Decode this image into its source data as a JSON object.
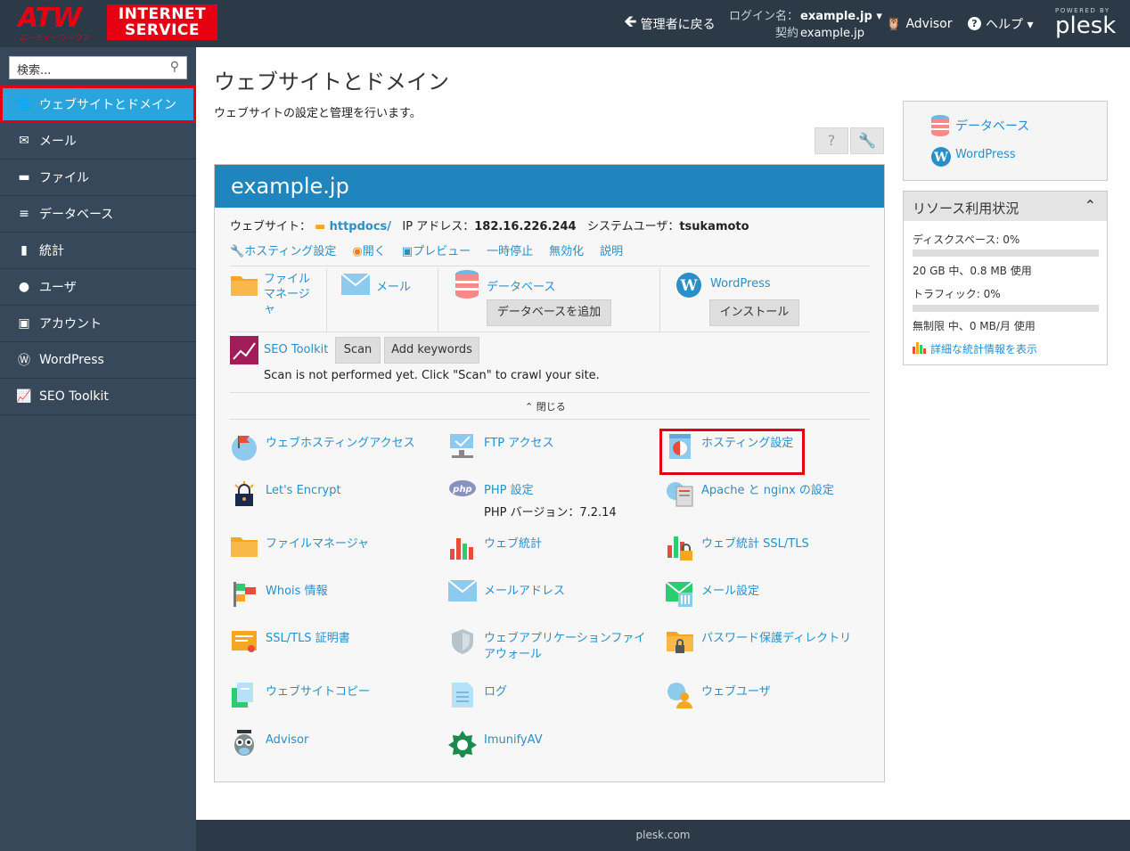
{
  "header": {
    "logo_main": "ATW",
    "logo_sub": "エーティーワークス",
    "logo_line1": "INTERNET",
    "logo_line2": "SERVICE",
    "back_label": "管理者に戻る",
    "login_label": "ログイン名：",
    "login_value": "example.jp ▾",
    "contract_label": "契約",
    "contract_value": "example.jp",
    "advisor_label": "Advisor",
    "help_label": "ヘルプ ▾",
    "powered_by": "POWERED BY",
    "brand": "plesk"
  },
  "sidebar": {
    "search_placeholder": "検索...",
    "items": [
      {
        "label": "ウェブサイトとドメイン",
        "icon": "globe-icon"
      },
      {
        "label": "メール",
        "icon": "mail-icon"
      },
      {
        "label": "ファイル",
        "icon": "folder-icon"
      },
      {
        "label": "データベース",
        "icon": "database-icon"
      },
      {
        "label": "統計",
        "icon": "chart-icon"
      },
      {
        "label": "ユーザ",
        "icon": "user-icon"
      },
      {
        "label": "アカウント",
        "icon": "account-icon"
      },
      {
        "label": "WordPress",
        "icon": "wordpress-icon"
      },
      {
        "label": "SEO Toolkit",
        "icon": "seo-icon"
      }
    ]
  },
  "main": {
    "title": "ウェブサイトとドメイン",
    "subtitle": "ウェブサイトの設定と管理を行います。",
    "domain": "example.jp",
    "website_label": "ウェブサイト：",
    "website_dir": "httpdocs/",
    "ip_label": "IP アドレス：",
    "ip_value": "182.16.226.244",
    "sysuser_label": "システムユーザ：",
    "sysuser_value": "tsukamoto",
    "actions": [
      "ホスティング設定",
      "開く",
      "プレビュー",
      "一時停止",
      "無効化",
      "説明"
    ],
    "quick": {
      "filemanager": "ファイルマネージャ",
      "mail": "メール",
      "database": "データベース",
      "add_db": "データベースを追加",
      "wordpress": "WordPress",
      "install": "インストール"
    },
    "seo": {
      "label": "SEO Toolkit",
      "scan": "Scan",
      "add_keywords": "Add keywords",
      "note": "Scan is not performed yet. Click \"Scan\" to crawl your site."
    },
    "close_label": "閉じる",
    "tiles": [
      {
        "label": "ウェブホスティングアクセス",
        "icon": "web-hosting-access-icon"
      },
      {
        "label": "FTP アクセス",
        "icon": "ftp-icon"
      },
      {
        "label": "ホスティング設定",
        "icon": "hosting-settings-icon"
      },
      {
        "label": "Let's Encrypt",
        "icon": "lets-encrypt-icon"
      },
      {
        "label": "PHP 設定",
        "icon": "php-icon",
        "sub": "PHP バージョン：7.2.14"
      },
      {
        "label": "Apache と nginx の設定",
        "icon": "apache-nginx-icon"
      },
      {
        "label": "ファイルマネージャ",
        "icon": "folder-icon"
      },
      {
        "label": "ウェブ統計",
        "icon": "web-stats-icon"
      },
      {
        "label": "ウェブ統計 SSL/TLS",
        "icon": "web-stats-ssl-icon"
      },
      {
        "label": "Whois 情報",
        "icon": "whois-icon"
      },
      {
        "label": "メールアドレス",
        "icon": "mail-address-icon"
      },
      {
        "label": "メール設定",
        "icon": "mail-settings-icon"
      },
      {
        "label": "SSL/TLS 証明書",
        "icon": "certificate-icon"
      },
      {
        "label": "ウェブアプリケーションファイアウォール",
        "icon": "firewall-icon"
      },
      {
        "label": "パスワード保護ディレクトリ",
        "icon": "protected-dir-icon"
      },
      {
        "label": "ウェブサイトコピー",
        "icon": "site-copy-icon"
      },
      {
        "label": "ログ",
        "icon": "logs-icon"
      },
      {
        "label": "ウェブユーザ",
        "icon": "web-users-icon"
      },
      {
        "label": "Advisor",
        "icon": "advisor-icon"
      },
      {
        "label": "ImunifyAV",
        "icon": "imunify-icon"
      }
    ]
  },
  "right": {
    "links": [
      "データベース",
      "WordPress"
    ],
    "resources_title": "リソース利用状況",
    "disk_label": "ディスクスペース: 0%",
    "disk_usage": 0,
    "disk_detail": "20 GB 中、0.8 MB 使用",
    "traffic_label": "トラフィック: 0%",
    "traffic_usage": 0,
    "traffic_detail": "無制限 中、0 MB/月 使用",
    "stats_link": "詳細な統計情報を表示"
  },
  "footer": {
    "text": "plesk.com"
  },
  "colors": {
    "header": "#2c3a47",
    "sidebar": "#37485a",
    "accent": "#1e85bd",
    "active": "#2aa4dc",
    "highlight": "#e50012",
    "link": "#2a8fc7"
  }
}
